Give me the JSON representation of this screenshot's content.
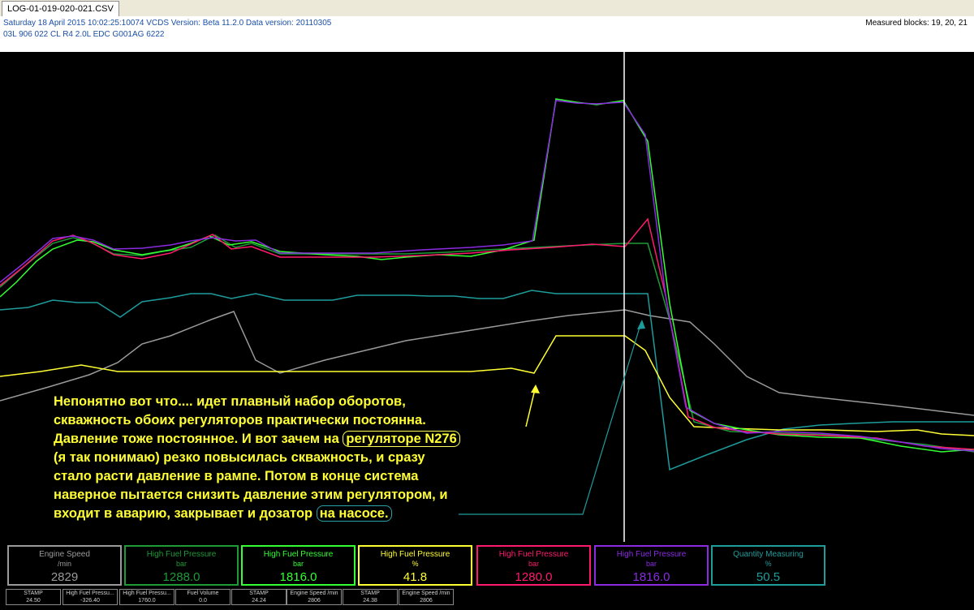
{
  "tab": {
    "label": "LOG-01-019-020-021.CSV"
  },
  "header": {
    "line1": "Saturday 18 April 2015 10:02:25:10074 VCDS Version: Beta 11.2.0 Data version: 20110305",
    "line2": "03L 906 022 CL  R4 2.0L EDC G001AG  6222",
    "blocks": "Measured blocks: 19, 20, 21"
  },
  "colors": {
    "gray": "#9a9a9a",
    "dark_green": "#1e9a36",
    "green": "#33ff33",
    "yellow": "#ffff33",
    "red": "#ff1a6e",
    "purple": "#8a2be2",
    "teal": "#1e9c9c",
    "cursor": "#ffffff"
  },
  "annotation": {
    "pre1": "Непонятно вот что.... идет плавный набор оборотов,\nскважность обоих регуляторов практически постоянна.\nДавление тоже постоянное. И вот зачем на ",
    "highlight1": "регуляторе N276",
    "mid": "\n(я так понимаю) резко повысилась скважность, и сразу\nстало расти давление в рампе. Потом в конце система\nнаверное пытается снизить давление этим регулятором, и\nвходит в аварию, закрывает и дозатор ",
    "highlight2": "на насосе."
  },
  "measurements": [
    {
      "name": "Engine Speed",
      "unit": "/min",
      "value": "2829",
      "color": "#9a9a9a"
    },
    {
      "name": "High Fuel Pressure",
      "unit": "bar",
      "value": "1288.0",
      "color": "#1e9a36"
    },
    {
      "name": "High Fuel Pressure",
      "unit": "bar",
      "value": "1816.0",
      "color": "#33ff33"
    },
    {
      "name": "High Fuel Pressure",
      "unit": "%",
      "value": "41.8",
      "color": "#ffff33"
    },
    {
      "name": "High Fuel Pressure",
      "unit": "bar",
      "value": "1280.0",
      "color": "#ff1a6e"
    },
    {
      "name": "High Fuel Pressure",
      "unit": "bar",
      "value": "1816.0",
      "color": "#8a2be2"
    },
    {
      "name": "Quantity Measuring",
      "unit": "%",
      "value": "50.5",
      "color": "#1e9c9c"
    }
  ],
  "small_boxes": [
    {
      "label": "STAMP",
      "value": "24.50"
    },
    {
      "label": "High Fuel Pressu...",
      "value": "-326.40"
    },
    {
      "label": "High Fuel Pressu...",
      "value": "1760.0"
    },
    {
      "label": "Fuel Volume",
      "value": "0.0"
    },
    {
      "label": "STAMP",
      "value": "24.24"
    },
    {
      "label": "Engine Speed /min",
      "value": "2806"
    },
    {
      "label": "STAMP",
      "value": "24.38"
    },
    {
      "label": "Engine Speed /min",
      "value": "2806"
    }
  ]
}
